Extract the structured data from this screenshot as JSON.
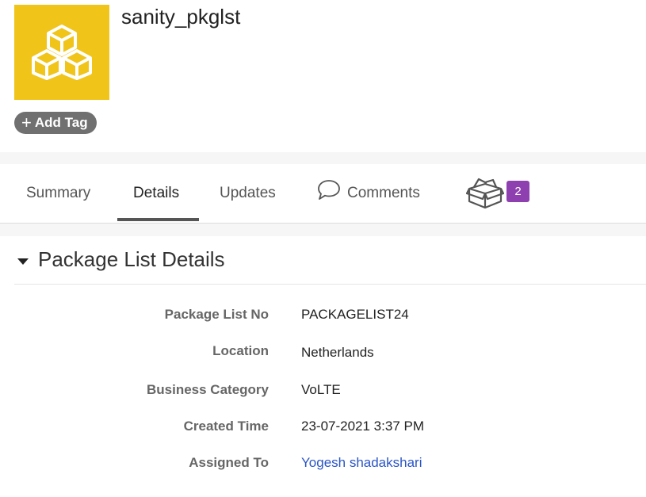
{
  "record": {
    "title": "sanity_pkglst",
    "icon": "cubes-icon",
    "add_tag_label": "Add Tag",
    "colors": {
      "tile": "#f0c419",
      "badge": "#8e3fb0",
      "link": "#2a55c5"
    }
  },
  "tabs": [
    {
      "label": "Summary",
      "active": false
    },
    {
      "label": "Details",
      "active": true
    },
    {
      "label": "Updates",
      "active": false
    },
    {
      "label": "Comments",
      "active": false,
      "icon": "comment-icon"
    },
    {
      "icon": "gift-box-icon",
      "badge": "2"
    }
  ],
  "section": {
    "title": "Package List Details",
    "fields": [
      {
        "label": "Package List No",
        "value": "PACKAGELIST24"
      },
      {
        "label": "Location",
        "value": "Netherlands"
      },
      {
        "label": "Business Category",
        "value": "VoLTE"
      },
      {
        "label": "Created Time",
        "value": "23-07-2021 3:37 PM"
      },
      {
        "label": "Assigned To",
        "value": "Yogesh shadakshari"
      }
    ]
  }
}
